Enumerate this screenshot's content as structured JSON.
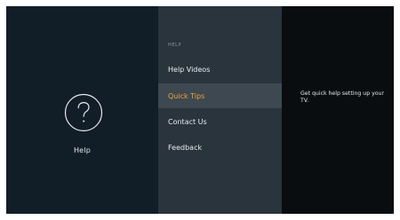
{
  "left_panel": {
    "icon": "question-circle-icon",
    "label": "Help"
  },
  "menu": {
    "section_label": "HELP",
    "items": [
      {
        "label": "Help Videos",
        "selected": false
      },
      {
        "label": "Quick Tips",
        "selected": true
      },
      {
        "label": "Contact Us",
        "selected": false
      },
      {
        "label": "Feedback",
        "selected": false
      }
    ]
  },
  "detail": {
    "description": "Get quick help setting up your TV."
  },
  "colors": {
    "accent": "#f0a72e",
    "selected_row": "#3e4851",
    "menu_bg": "#2a343d",
    "left_bg": "#121e27",
    "right_bg": "#0a0d10"
  }
}
